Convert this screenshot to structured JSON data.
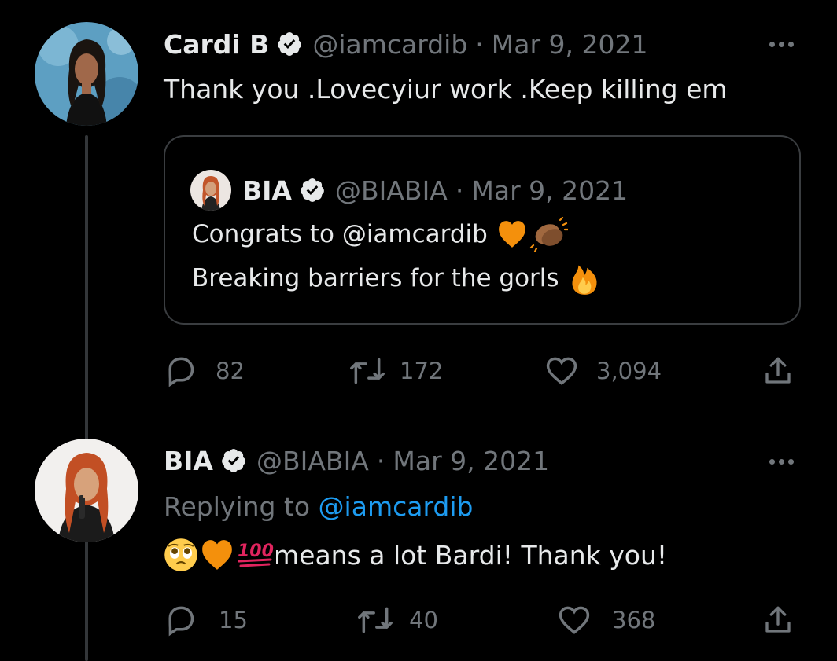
{
  "tweet1": {
    "name": "Cardi B",
    "handle": "@iamcardib",
    "separator": "·",
    "date": "Mar 9, 2021",
    "text": "Thank you .Lovecyiur work .Keep killing em",
    "avatar_icon": "avatar-photo",
    "quote": {
      "name": "BIA",
      "handle": "@BIABIA",
      "separator": "·",
      "date": "Mar 9, 2021",
      "line1": "Congrats to @iamcardib",
      "line2": "Breaking barriers for the gorls",
      "emojis_line1": [
        "orange-heart",
        "clapping-hands"
      ],
      "emojis_line2": [
        "fire"
      ]
    },
    "stats": {
      "replies": "82",
      "retweets": "172",
      "likes": "3,094"
    }
  },
  "tweet2": {
    "name": "BIA",
    "handle": "@BIABIA",
    "separator": "·",
    "date": "Mar 9, 2021",
    "replying_prefix": "Replying to",
    "replying_mention": "@iamcardib",
    "text": "means a lot Bardi! Thank you!",
    "emojis": [
      "pleading-face",
      "orange-heart",
      "hundred-points"
    ],
    "stats": {
      "replies": "15",
      "retweets": "40",
      "likes": "368"
    }
  },
  "colors": {
    "background": "#000000",
    "text": "#e7e9ea",
    "muted": "#71767b",
    "link": "#1d9bf0",
    "verified_badge": "#e7e9ea",
    "orange_heart": "#f4900c"
  }
}
